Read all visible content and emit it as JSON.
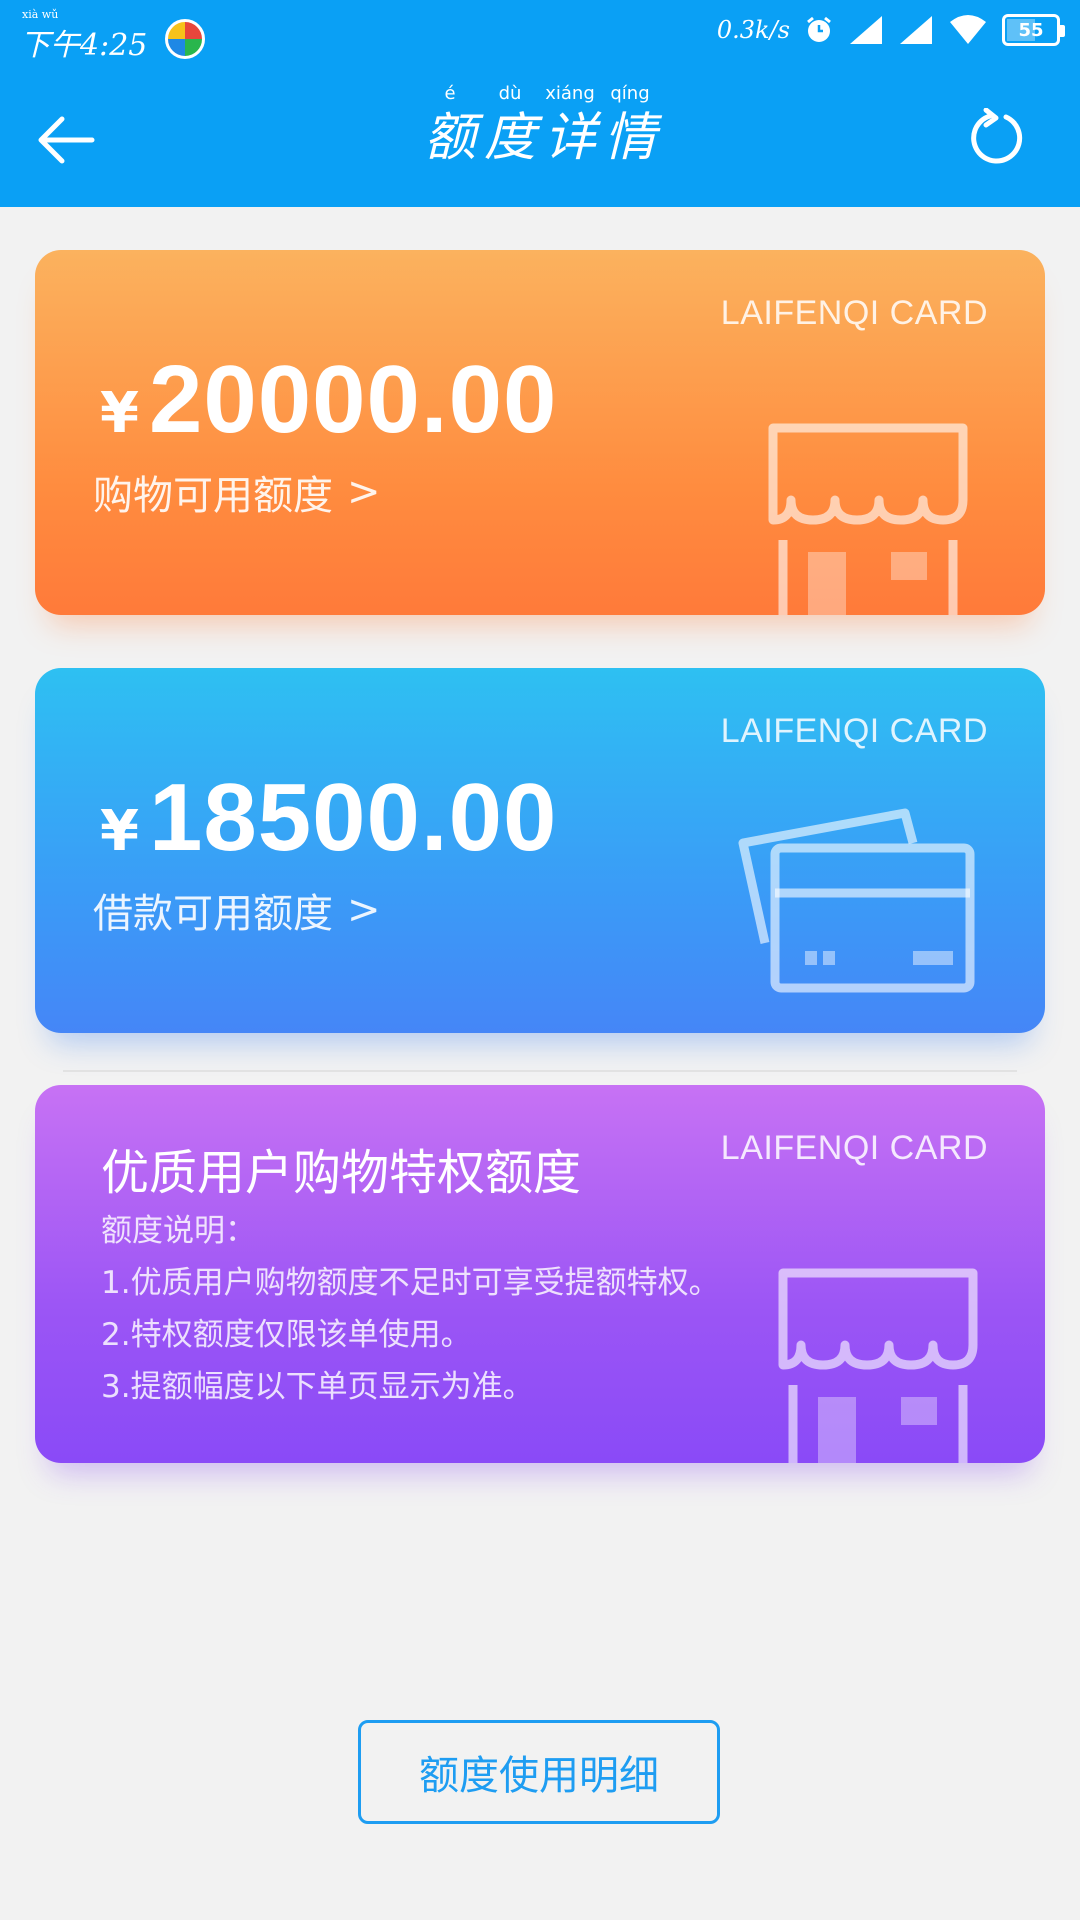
{
  "status_bar": {
    "time_pinyin": "xià wǔ",
    "time": "下午4:25",
    "network_speed": "0.3k/s",
    "battery_level": "55"
  },
  "header": {
    "title": [
      {
        "pinyin": "é",
        "char": "额"
      },
      {
        "pinyin": "dù",
        "char": "度"
      },
      {
        "pinyin": "xiáng",
        "char": "详"
      },
      {
        "pinyin": "qíng",
        "char": "情"
      }
    ],
    "back_icon": "arrow-left-icon",
    "refresh_icon": "refresh-icon"
  },
  "cards": {
    "shopping": {
      "brand": "LAIFENQI CARD",
      "currency": "¥",
      "amount": "20000.00",
      "label": "购物可用额度",
      "chevron": ">",
      "icon": "store-icon"
    },
    "loan": {
      "brand": "LAIFENQI CARD",
      "currency": "¥",
      "amount": "18500.00",
      "label": "借款可用额度",
      "chevron": ">",
      "icon": "bank-card-icon"
    },
    "premium": {
      "brand": "LAIFENQI CARD",
      "title": "优质用户购物特权额度",
      "notes_title": "额度说明：",
      "notes": [
        "1.优质用户购物额度不足时可享受提额特权。",
        "2.特权额度仅限该单使用。",
        "3.提额幅度以下单页显示为准。"
      ],
      "icon": "store-icon"
    }
  },
  "footer": {
    "detail_button": "额度使用明细"
  },
  "colors": {
    "primary": "#0aa0f5",
    "button_border": "#1e9df2",
    "background": "#f2f2f2"
  }
}
